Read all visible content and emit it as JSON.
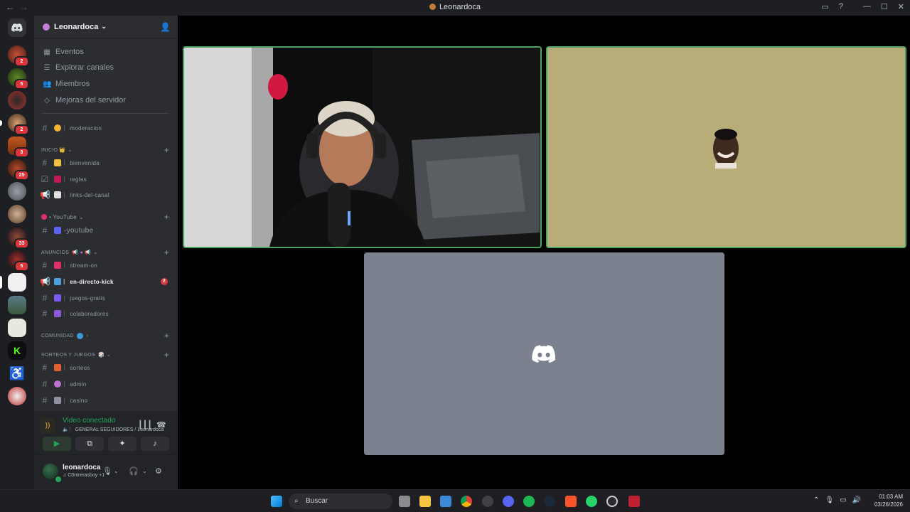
{
  "window": {
    "title": "Leonardoca"
  },
  "server_rail": {
    "badges": [
      "2",
      "5",
      "",
      "2",
      "3",
      "25",
      "",
      "",
      "33",
      "5",
      "",
      "",
      "",
      "",
      "",
      ""
    ]
  },
  "sidebar": {
    "guild_name": "Leonardoca",
    "nav": [
      "Eventos",
      "Explorar canales",
      "Miembros",
      "Mejoras del servidor"
    ],
    "channels": [
      {
        "name": "︳moderacion"
      },
      {
        "category": "INICIO 👑"
      },
      {
        "name": "︳bienvenida"
      },
      {
        "name": "︳reglas"
      },
      {
        "name": "︳links-del-canal"
      },
      {
        "category": "• YouTube"
      },
      {
        "name": "-youtube"
      },
      {
        "category": "ANUNCIOS"
      },
      {
        "name": "︳stream-on"
      },
      {
        "name": "︳en-directo-kick",
        "badge": "2"
      },
      {
        "name": "︳juegos-gratis"
      },
      {
        "name": "︳colaboradores"
      },
      {
        "category": "COMUNIDAD"
      },
      {
        "category": "SORTEOS Y JUEGOS"
      },
      {
        "name": "︳sorteos"
      },
      {
        "name": "︳admin"
      },
      {
        "name": "︳casino"
      }
    ]
  },
  "voice_panel": {
    "status": "Video conectado",
    "channel": "︳GENERAL SEGUIDORES / Leonardoca"
  },
  "user_panel": {
    "username": "leonardoca",
    "activity": "C0ntrerasboy +1"
  },
  "taskbar": {
    "search_placeholder": "Buscar",
    "time": "01:03 AM",
    "date": "03/26/2026"
  },
  "colors": {
    "speaking_border": "#4aa45f",
    "mention_badge": "#da373c",
    "connected_green": "#23a559"
  }
}
